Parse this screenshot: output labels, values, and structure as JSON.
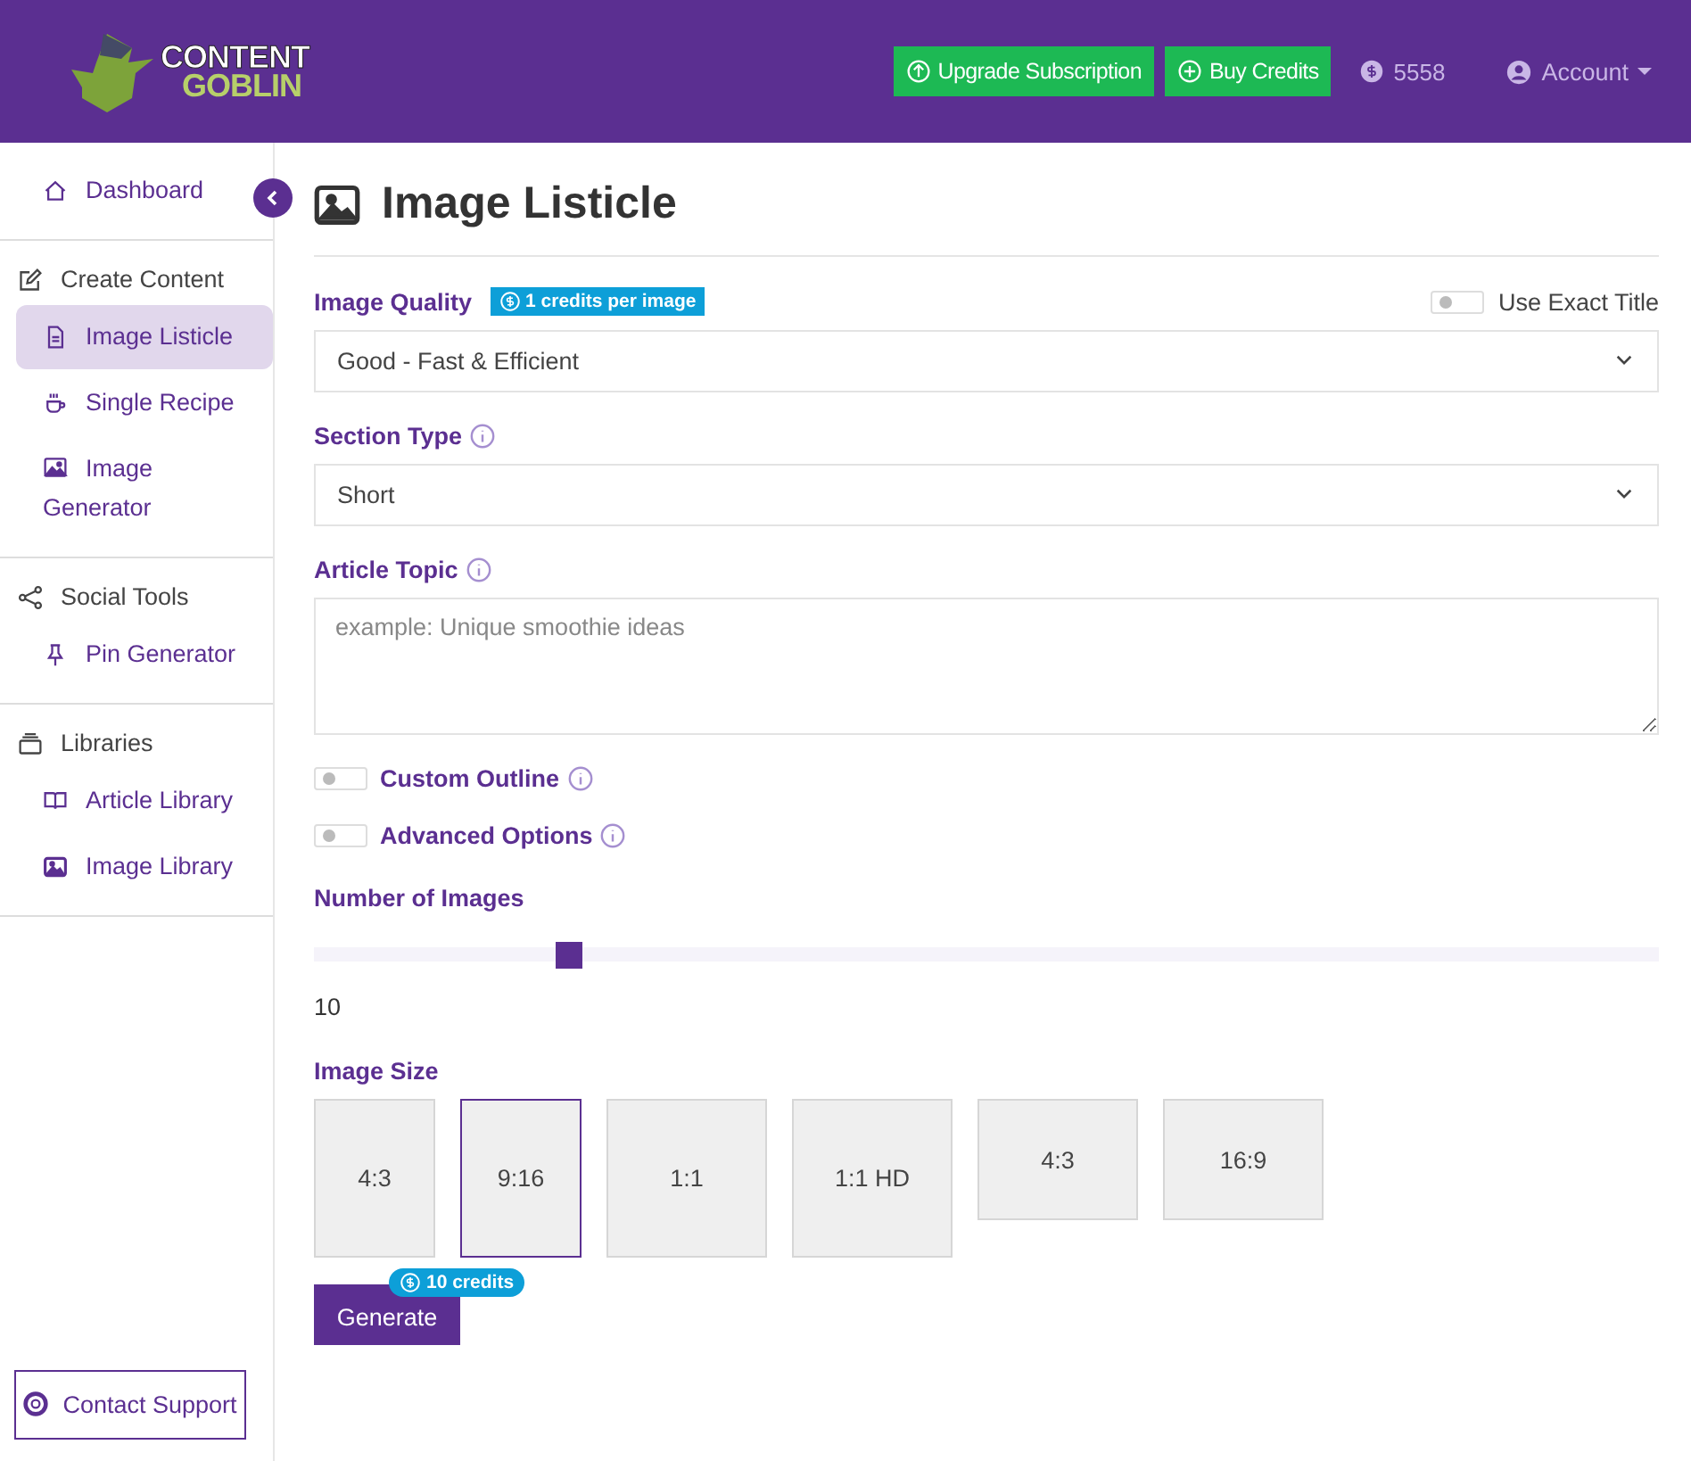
{
  "header": {
    "logo": [
      "CONTENT",
      "GOBLIN"
    ],
    "buttons": [
      "Upgrade Subscription",
      "Buy Credits"
    ],
    "credits": "5558",
    "account": "Account"
  },
  "sidebar": {
    "top": {
      "label": "Dashboard",
      "selected": false
    },
    "groups": [
      {
        "heading": "Create Content",
        "items": [
          {
            "label": "Image Listicle",
            "selected": true
          },
          {
            "label": "Single Recipe",
            "selected": false
          },
          {
            "label": "Image Generator",
            "selected": false
          }
        ]
      },
      {
        "heading": "Social Tools",
        "items": [
          {
            "label": "Pin Generator",
            "selected": false
          }
        ]
      },
      {
        "heading": "Libraries",
        "items": [
          {
            "label": "Article Library",
            "selected": false
          },
          {
            "label": "Image Library",
            "selected": false
          }
        ]
      }
    ],
    "support": "Contact Support"
  },
  "page": {
    "title": "Image Listicle",
    "image_quality": {
      "label": "Image Quality",
      "badge": "1 credits per image",
      "toggle": {
        "label": "Use Exact Title",
        "on": false
      },
      "value": "Good - Fast & Efficient"
    },
    "section_type": {
      "label": "Section Type",
      "info": true,
      "value": "Short"
    },
    "article_topic": {
      "label": "Article Topic",
      "info": true,
      "placeholder": "example: Unique smoothie ideas"
    },
    "toggles": [
      {
        "label": "Custom Outline",
        "on": false,
        "info": true
      },
      {
        "label": "Advanced Options",
        "on": false,
        "info": true
      }
    ],
    "number_of_images": {
      "label": "Number of Images",
      "level": 0.19,
      "reading": "10"
    },
    "image_size": {
      "label": "Image Size",
      "options": [
        {
          "label": "4:3",
          "kind": "narrow",
          "selected": false
        },
        {
          "label": "9:16",
          "kind": "narrow",
          "selected": true
        },
        {
          "label": "1:1",
          "kind": "square",
          "selected": false
        },
        {
          "label": "1:1 HD",
          "kind": "square",
          "selected": false
        },
        {
          "label": "4:3",
          "kind": "wide",
          "selected": false
        },
        {
          "label": "16:9",
          "kind": "wide",
          "selected": false
        }
      ]
    },
    "generate": {
      "label": "Generate",
      "badge": "10 credits"
    }
  }
}
